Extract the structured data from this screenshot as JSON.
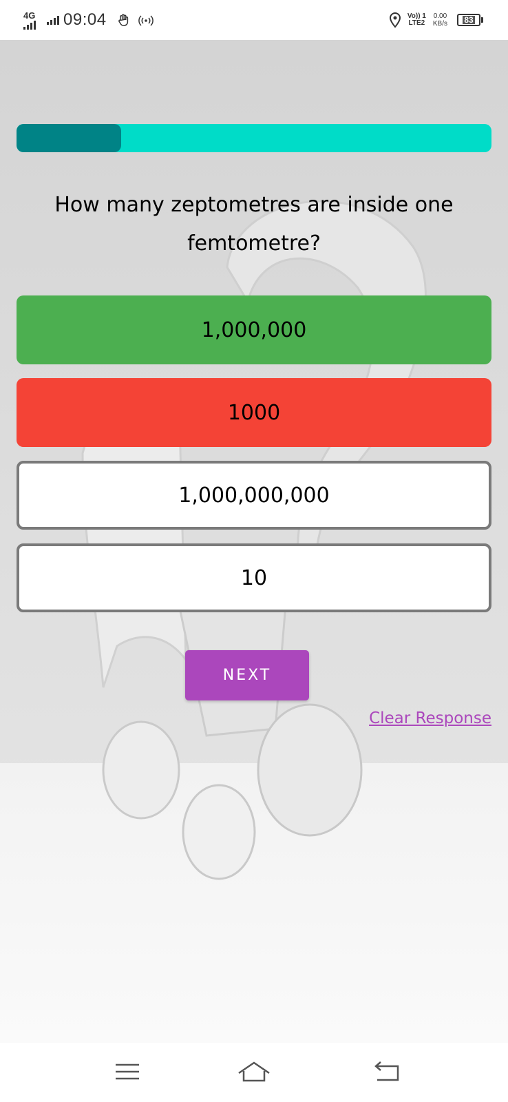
{
  "status_bar": {
    "network": "4G",
    "time": "09:04",
    "volte_line1": "Vo)) 1",
    "volte_line2": "LTE2",
    "speed_value": "0.00",
    "speed_unit": "KB/s",
    "battery": "83",
    "icons": [
      "signal-icon",
      "signal-icon",
      "hand-icon",
      "hotspot-icon",
      "location-icon",
      "battery-icon"
    ]
  },
  "quiz": {
    "progress_fraction": 0.22,
    "question": "How many zeptometres are inside one femtometre?",
    "options": [
      {
        "label": "1,000,000",
        "state": "correct"
      },
      {
        "label": "1000",
        "state": "wrong"
      },
      {
        "label": "1,000,000,000",
        "state": "unselected"
      },
      {
        "label": "10",
        "state": "unselected"
      }
    ],
    "next_label": "NEXT",
    "clear_label": "Clear Response"
  },
  "colors": {
    "progress_track": "#00dcc8",
    "progress_fill": "#008386",
    "correct": "#4caf50",
    "wrong": "#f44336",
    "accent": "#ab47bc"
  },
  "nav_bar": {
    "icons": [
      "menu-icon",
      "home-icon",
      "back-icon"
    ]
  }
}
